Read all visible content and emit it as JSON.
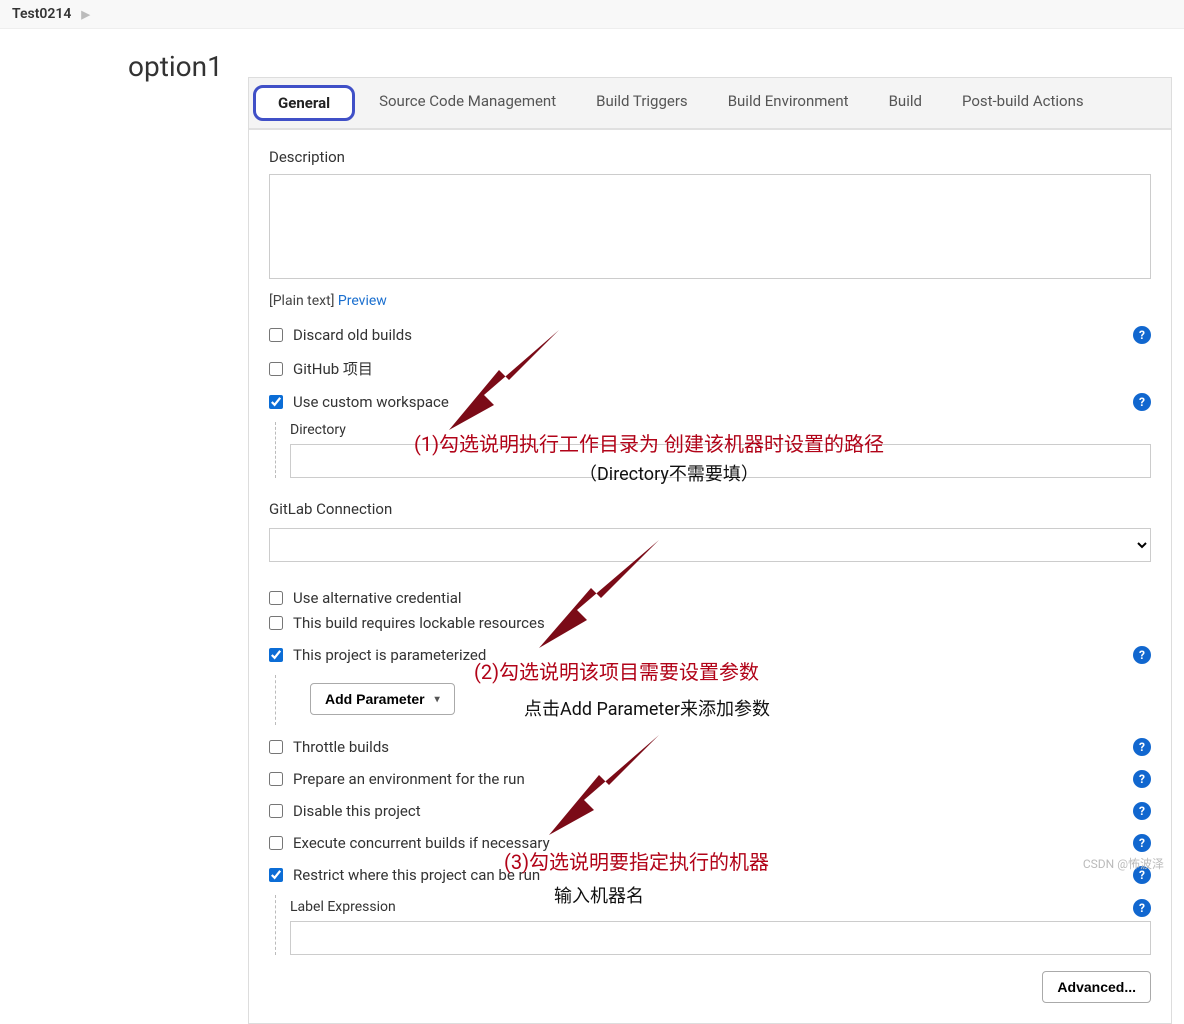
{
  "breadcrumb": {
    "project": "Test0214"
  },
  "option_label": "option1",
  "tabs": [
    {
      "label": "General",
      "active": true
    },
    {
      "label": "Source Code Management"
    },
    {
      "label": "Build Triggers"
    },
    {
      "label": "Build Environment"
    },
    {
      "label": "Build"
    },
    {
      "label": "Post-build Actions"
    }
  ],
  "description": {
    "label": "Description",
    "value": ""
  },
  "plain_text": {
    "prefix": "[Plain text] ",
    "preview": "Preview"
  },
  "options": {
    "discard_old_builds": {
      "label": "Discard old builds",
      "checked": false
    },
    "github_project": {
      "label": "GitHub 项目",
      "checked": false
    },
    "use_custom_workspace": {
      "label": "Use custom workspace",
      "checked": true,
      "directory_label": "Directory",
      "directory_value": ""
    },
    "gitlab_connection": {
      "label": "GitLab Connection",
      "value": ""
    },
    "use_alt_cred": {
      "label": "Use alternative credential",
      "checked": false
    },
    "lockable": {
      "label": "This build requires lockable resources",
      "checked": false
    },
    "parameterized": {
      "label": "This project is parameterized",
      "checked": true,
      "add_parameter": "Add Parameter"
    },
    "throttle": {
      "label": "Throttle builds",
      "checked": false
    },
    "prepare_env": {
      "label": "Prepare an environment for the run",
      "checked": false
    },
    "disable_project": {
      "label": "Disable this project",
      "checked": false
    },
    "concurrent": {
      "label": "Execute concurrent builds if necessary",
      "checked": false
    },
    "restrict": {
      "label": "Restrict where this project can be run",
      "checked": true,
      "label_expression_label": "Label Expression",
      "label_expression_value": ""
    }
  },
  "advanced_button": "Advanced...",
  "annotations": {
    "a1": "(1)勾选说明执行工作目录为 创建该机器时设置的路径",
    "a1b": "（Directory不需要填）",
    "a2": "(2)勾选说明该项目需要设置参数",
    "a2b": "点击Add Parameter来添加参数",
    "a3": "(3)勾选说明要指定执行的机器",
    "a3b": "输入机器名"
  },
  "watermark": "CSDN @怖波泽"
}
